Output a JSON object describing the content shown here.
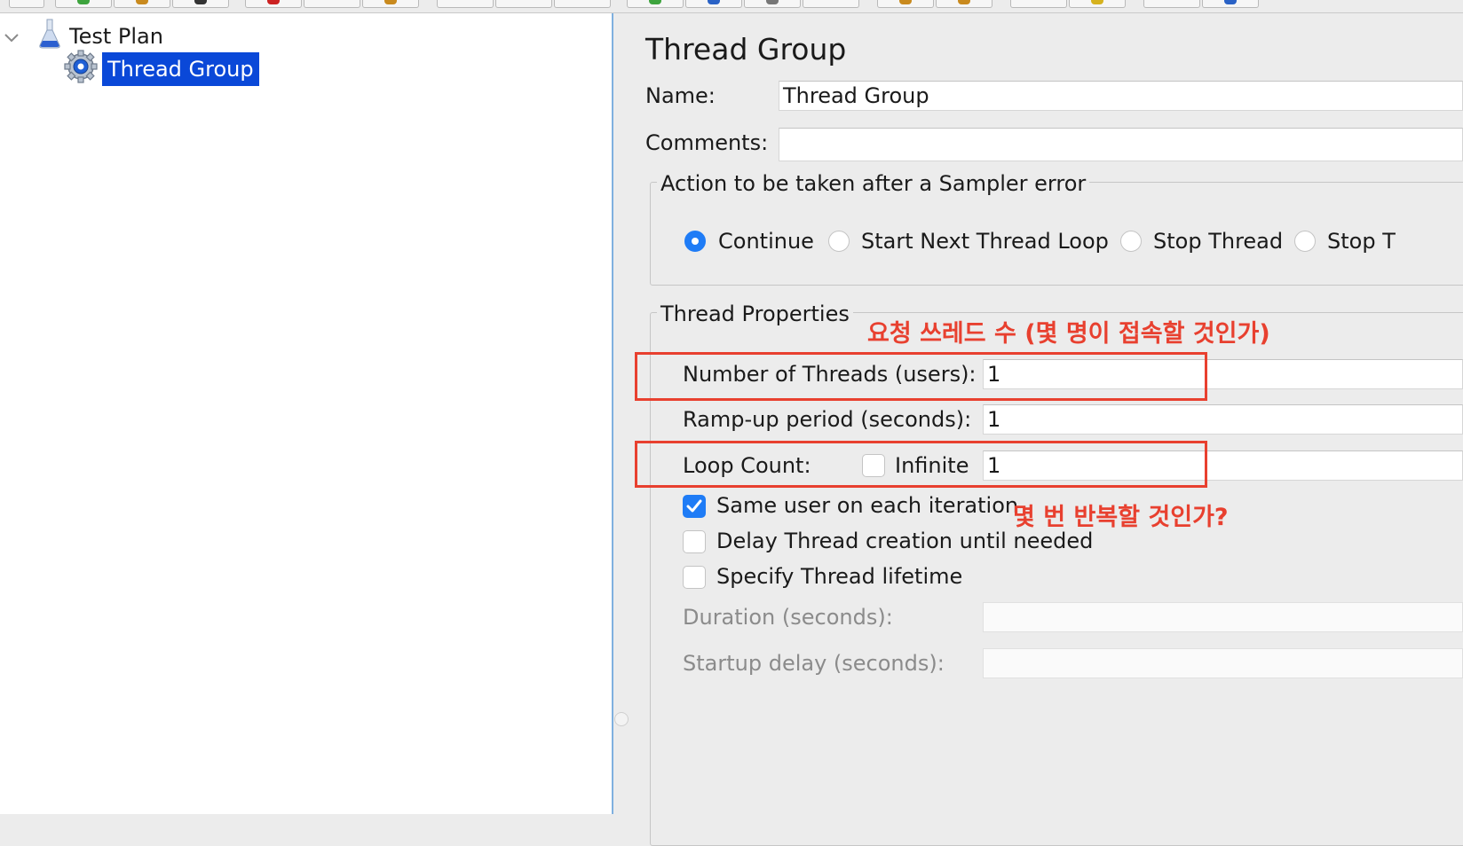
{
  "tree": {
    "items": [
      {
        "label": "Test Plan",
        "icon": "flask-icon",
        "expanded": true
      },
      {
        "label": "Thread Group",
        "icon": "gear-icon",
        "selected": true
      }
    ]
  },
  "editor": {
    "title": "Thread Group",
    "name_label": "Name:",
    "name_value": "Thread Group",
    "comments_label": "Comments:",
    "comments_value": "",
    "sampler_error": {
      "legend": "Action to be taken after a Sampler error",
      "options": [
        "Continue",
        "Start Next Thread Loop",
        "Stop Thread",
        "Stop T"
      ],
      "selected": "Continue"
    },
    "thread_properties": {
      "legend": "Thread Properties",
      "threads_label": "Number of Threads (users):",
      "threads_value": "1",
      "rampup_label": "Ramp-up period (seconds):",
      "rampup_value": "1",
      "loop_label": "Loop Count:",
      "infinite_label": "Infinite",
      "infinite_checked": false,
      "loop_value": "1",
      "same_user_label": "Same user on each iteration",
      "same_user_checked": true,
      "delay_label": "Delay Thread creation until needed",
      "delay_checked": false,
      "lifetime_label": "Specify Thread lifetime",
      "lifetime_checked": false,
      "duration_label": "Duration (seconds):",
      "duration_value": "",
      "startup_label": "Startup delay (seconds):",
      "startup_value": ""
    }
  },
  "annotations": {
    "threads_note": "요청 쓰레드 수 (몇 명이 접속할 것인가)",
    "loop_note": "몇 번 반복할 것인가?"
  },
  "colors": {
    "selection": "#0a48d8",
    "accent": "#1f7cf6",
    "annotation": "#e8402f"
  }
}
